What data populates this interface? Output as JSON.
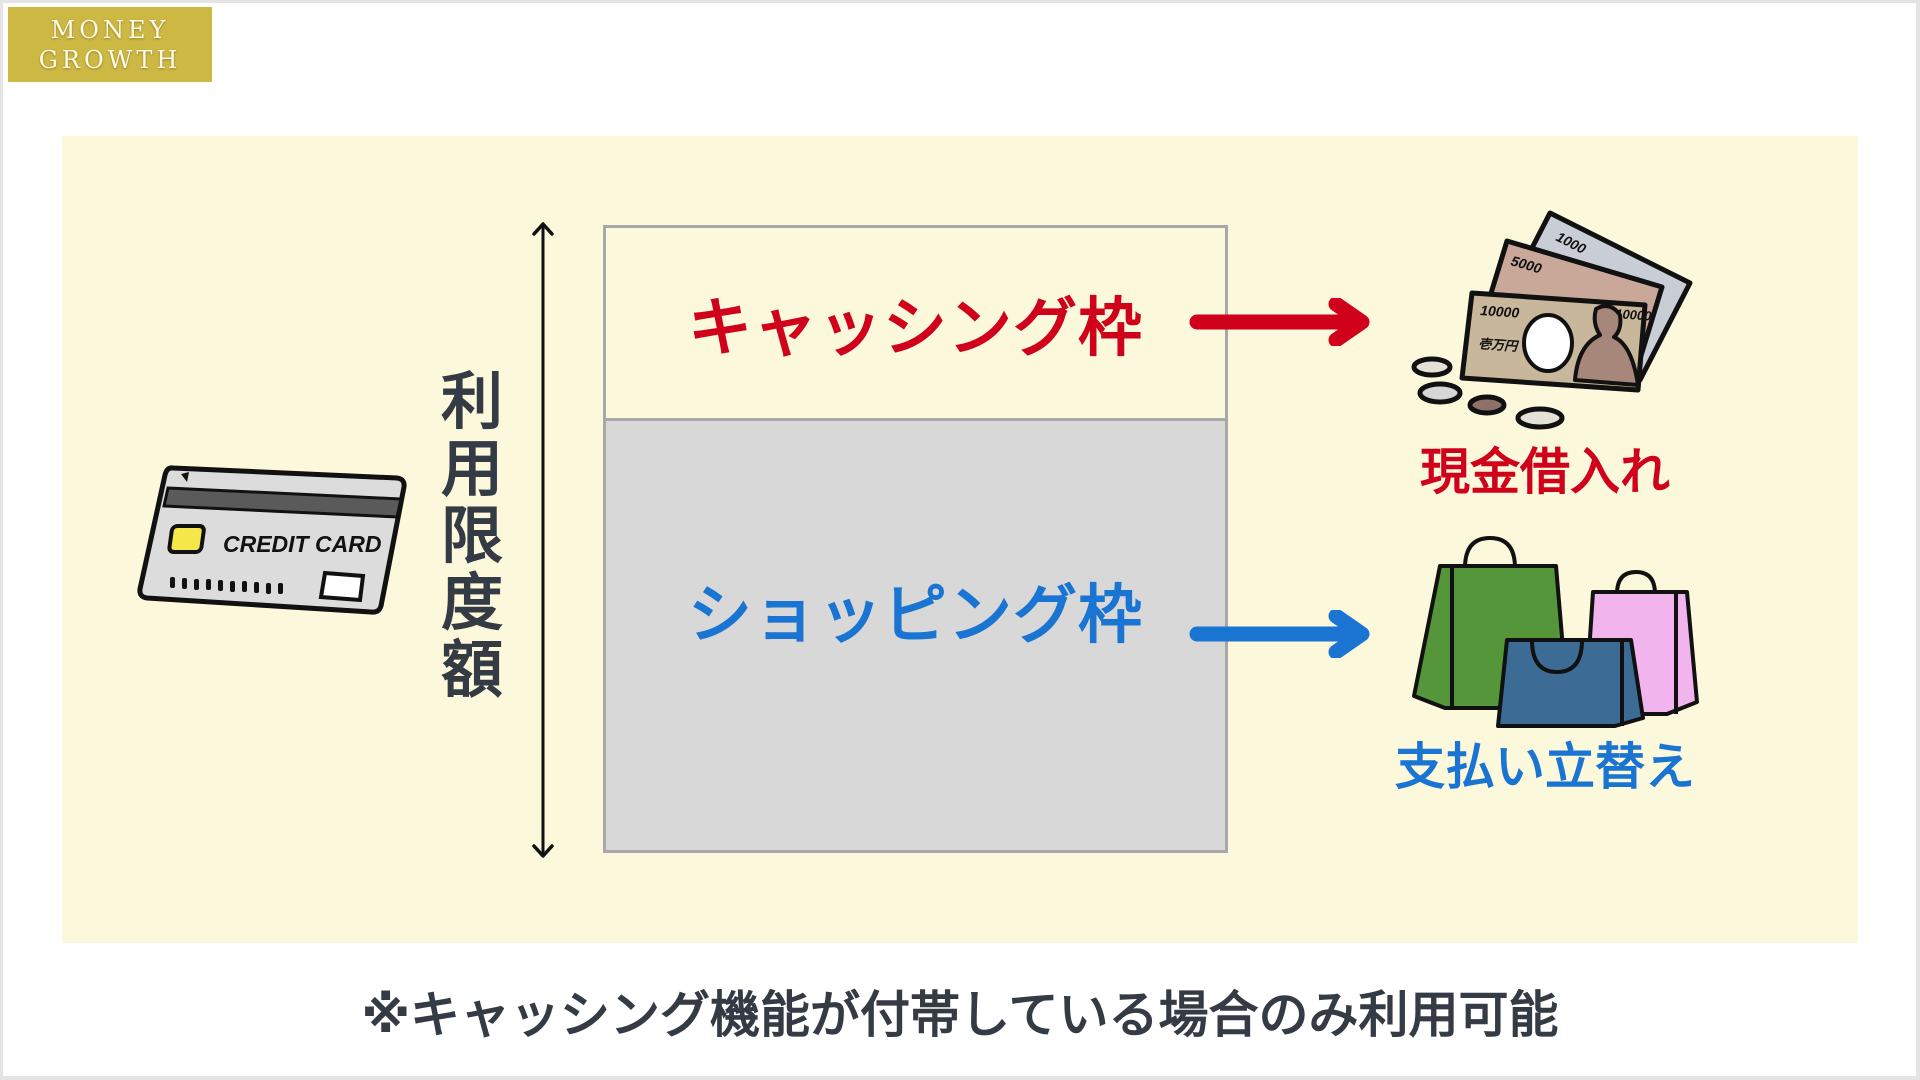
{
  "logo": {
    "line1": "MONEY",
    "line2": "GROWTH"
  },
  "diagram": {
    "vertical_label_chars": [
      "利",
      "用",
      "限",
      "度",
      "額"
    ],
    "cashing_frame_label": "キャッシング枠",
    "shopping_frame_label": "ショッピング枠",
    "cash_result_label": "現金借入れ",
    "shopping_result_label": "支払い立替え",
    "credit_card_text": "CREDIT CARD",
    "banknotes": {
      "note1000": "1000",
      "note5000": "5000",
      "note10000": "10000",
      "note_kanji": "壱万円"
    }
  },
  "footer": {
    "note": "※キャッシング機能が付帯している場合のみ利用可能"
  },
  "colors": {
    "cashing": "#d0021b",
    "shopping": "#1a74d2",
    "panel": "#fcf8dc",
    "shopping_area": "#d8d8d8",
    "logo_bg": "#cdb843",
    "text_dark": "#353b45"
  }
}
